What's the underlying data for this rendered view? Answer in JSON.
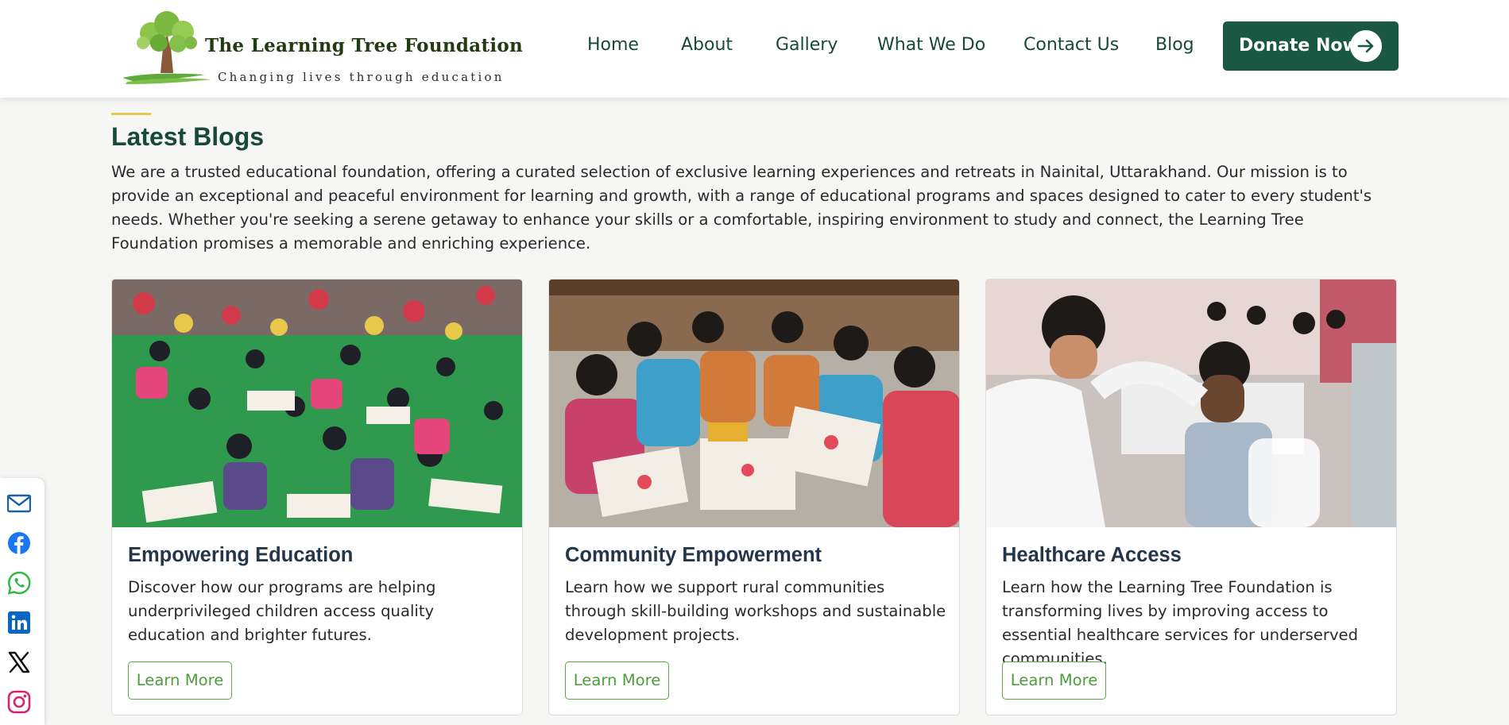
{
  "brand": {
    "name": "The Learning Tree Foundation",
    "tagline": "Changing lives through education"
  },
  "nav": {
    "items": [
      {
        "label": "Home"
      },
      {
        "label": "About"
      },
      {
        "label": "Gallery"
      },
      {
        "label": "What We Do"
      },
      {
        "label": "Contact Us"
      },
      {
        "label": "Blog"
      }
    ],
    "donate_label": "Donate Now",
    "donate_icon": "arrow-right-icon"
  },
  "section": {
    "title": "Latest Blogs",
    "intro": "We are a trusted educational foundation, offering a curated selection of exclusive learning experiences and retreats in Nainital, Uttarakhand. Our mission is to provide an exceptional and peaceful environment for learning and growth, with a range of educational programs and spaces designed to cater to every student's needs. Whether you're seeking a serene getaway to enhance your skills or a comfortable, inspiring environment to study and connect, the Learning Tree Foundation promises a memorable and enriching experience."
  },
  "cards": [
    {
      "title": "Empowering Education",
      "text": "Discover how our programs are helping underprivileged children access quality education and brighter futures.",
      "button": "Learn More"
    },
    {
      "title": "Community Empowerment",
      "text": "Learn how we support rural communities through skill-building workshops and sustainable development projects.",
      "button": "Learn More"
    },
    {
      "title": "Healthcare Access",
      "text": "Learn how the Learning Tree Foundation is transforming lives by improving access to essential healthcare services for underserved communities.",
      "button": "Learn More"
    }
  ],
  "social": [
    "email-icon",
    "facebook-icon",
    "whatsapp-icon",
    "linkedin-icon",
    "x-icon",
    "instagram-icon"
  ],
  "colors": {
    "brand_green": "#1b5844",
    "nav_text": "#17493a",
    "accent_yellow": "#e4c84a",
    "button_green": "#5aa745",
    "card_title": "#23364a",
    "page_bg": "#f6f6f4"
  }
}
